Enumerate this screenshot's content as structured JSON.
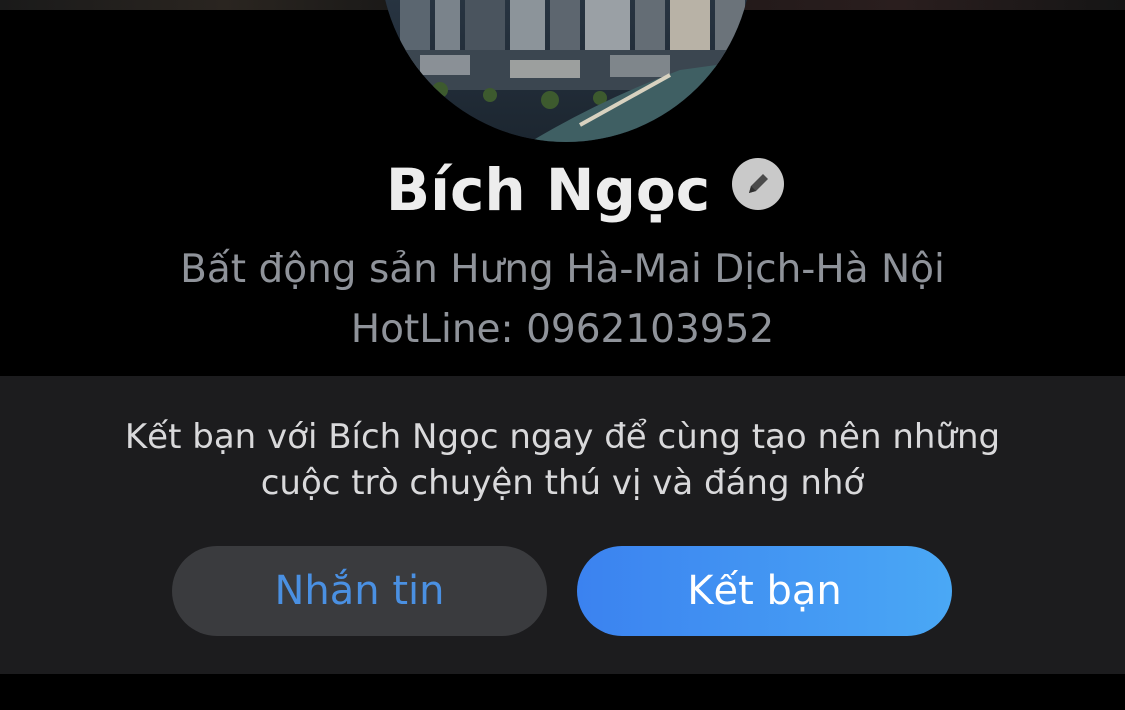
{
  "profile": {
    "name": "Bích Ngọc",
    "bio_line1": "Bất động sản Hưng Hà-Mai Dịch-Hà Nội",
    "bio_line2": "HotLine: 0962103952",
    "avatar_icon": "cityscape-photo",
    "edit_icon": "pencil-icon"
  },
  "friend_prompt": {
    "line1": "Kết bạn với Bích Ngọc ngay để cùng tạo nên những",
    "line2": "cuộc trò chuyện thú vị và đáng nhớ"
  },
  "actions": {
    "message_label": "Nhắn tin",
    "add_friend_label": "Kết bạn"
  },
  "colors": {
    "accent": "#4a90e2",
    "primary_gradient_start": "#3b82f0",
    "primary_gradient_end": "#4aa8f5",
    "panel_bg": "#1c1c1e",
    "secondary_button_bg": "#3a3b3e"
  }
}
